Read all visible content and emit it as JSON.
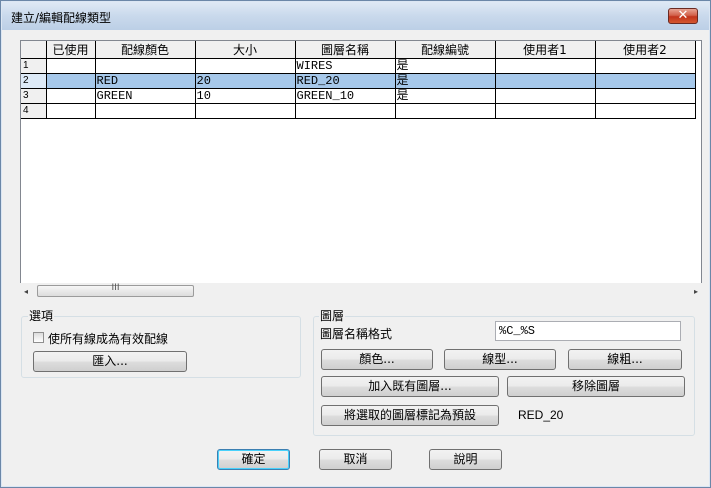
{
  "window": {
    "title": "建立/編輯配線類型",
    "close_label": "✕"
  },
  "grid": {
    "columns": [
      "已使用",
      "配線顏色",
      "大小",
      "圖層名稱",
      "配線編號",
      "使用者1",
      "使用者2"
    ],
    "rows": [
      {
        "num": "1",
        "used": "",
        "color": "",
        "size": "",
        "layer": "WIRES",
        "wirenum": "是",
        "user1": "",
        "user2": ""
      },
      {
        "num": "2",
        "used": "",
        "color": "RED",
        "size": "20",
        "layer": "RED_20",
        "wirenum": "是",
        "user1": "",
        "user2": ""
      },
      {
        "num": "3",
        "used": "",
        "color": "GREEN",
        "size": "10",
        "layer": "GREEN_10",
        "wirenum": "是",
        "user1": "",
        "user2": ""
      },
      {
        "num": "4",
        "used": "",
        "color": "",
        "size": "",
        "layer": "",
        "wirenum": "",
        "user1": "",
        "user2": ""
      }
    ],
    "selected_row": "2"
  },
  "scrollbar": {
    "left_arrow": "◂",
    "right_arrow": "▸",
    "thumb_grip": "III"
  },
  "options": {
    "label": "選項",
    "checkbox_label": "使所有線成為有效配線",
    "checkbox_checked": false,
    "import_button": "匯入..."
  },
  "layer": {
    "label": "圖層",
    "name_format_label": "圖層名稱格式",
    "name_format_value": "%C_%S",
    "color_button": "顏色...",
    "linetype_button": "線型...",
    "lineweight_button": "線粗...",
    "add_existing_button": "加入既有圖層...",
    "remove_button": "移除圖層",
    "mark_default_button": "將選取的圖層標記為預設",
    "default_value": "RED_20"
  },
  "footer": {
    "ok": "確定",
    "cancel": "取消",
    "help": "說明"
  }
}
